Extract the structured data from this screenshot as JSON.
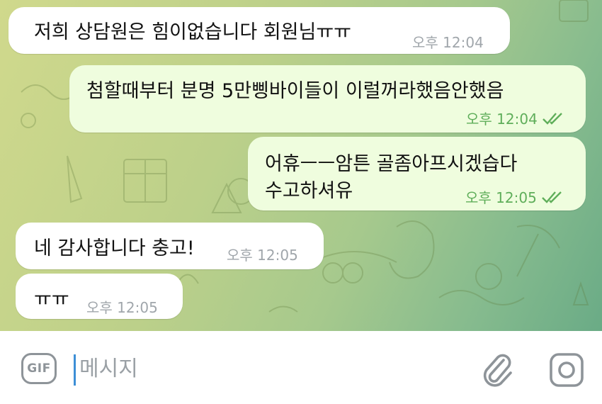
{
  "messages": [
    {
      "direction": "incoming",
      "lines": [
        "저희 상담원은 힘이없습니다 회원님ㅠㅠ"
      ],
      "time": "오후 12:04",
      "read_ticks": false
    },
    {
      "direction": "outgoing",
      "lines": [
        "첨할때부터 분명 5만삥바이들이 이럴꺼라했음안했음"
      ],
      "time": "오후 12:04",
      "read_ticks": true
    },
    {
      "direction": "outgoing",
      "lines": [
        "어휴ㅡㅡ암튼 골좀아프시겠습다",
        "수고하셔유"
      ],
      "time": "오후 12:05",
      "read_ticks": true
    },
    {
      "direction": "incoming",
      "lines": [
        "네 감사합니다 충고!"
      ],
      "time": "오후 12:05",
      "read_ticks": false
    },
    {
      "direction": "incoming",
      "lines": [
        "ㅠㅠ"
      ],
      "time": "오후 12:05",
      "read_ticks": false
    }
  ],
  "composer": {
    "placeholder": "메시지",
    "gif_label": "GIF",
    "icons": {
      "gif": "gif-icon",
      "attach": "paperclip-icon",
      "camera": "camera-icon"
    }
  },
  "colors": {
    "incoming_bubble": "#ffffff",
    "outgoing_bubble": "#effdde",
    "outgoing_meta": "#5fae5a",
    "incoming_meta": "#a0a6ab",
    "caret": "#3d8fd6"
  }
}
